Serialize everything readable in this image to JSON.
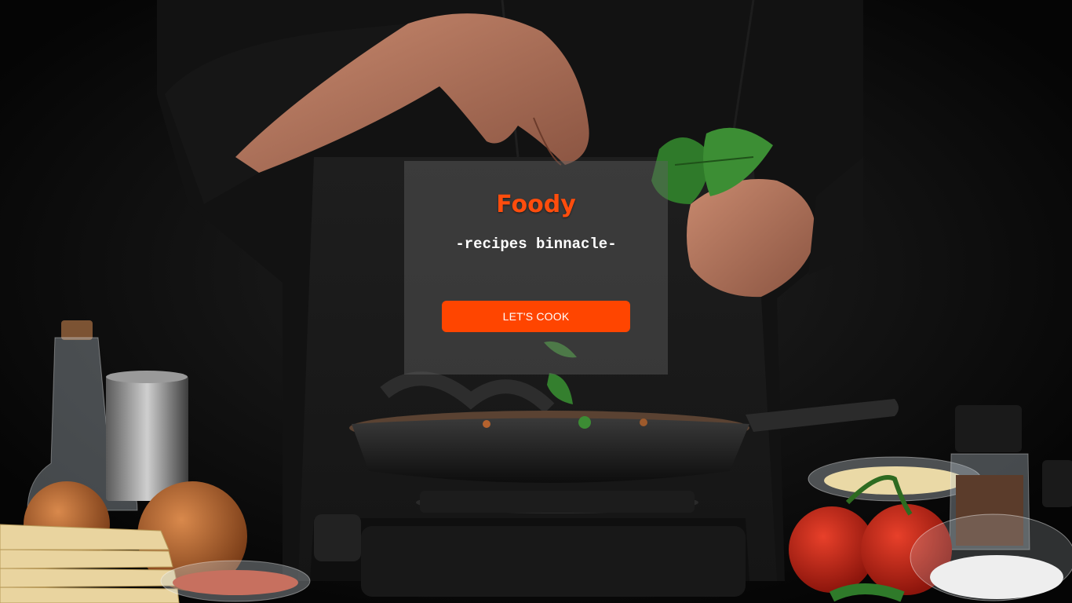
{
  "hero": {
    "image": "chef-cooking-photo",
    "brand_title": "Foody",
    "tagline": "-recipes binnacle-",
    "cta_label": "LET'S COOK"
  },
  "colors": {
    "accent": "#ff4500",
    "brand_title": "#ff4d0d",
    "card_overlay": "rgba(95,95,95,0.45)",
    "text_light": "#ffffff"
  }
}
